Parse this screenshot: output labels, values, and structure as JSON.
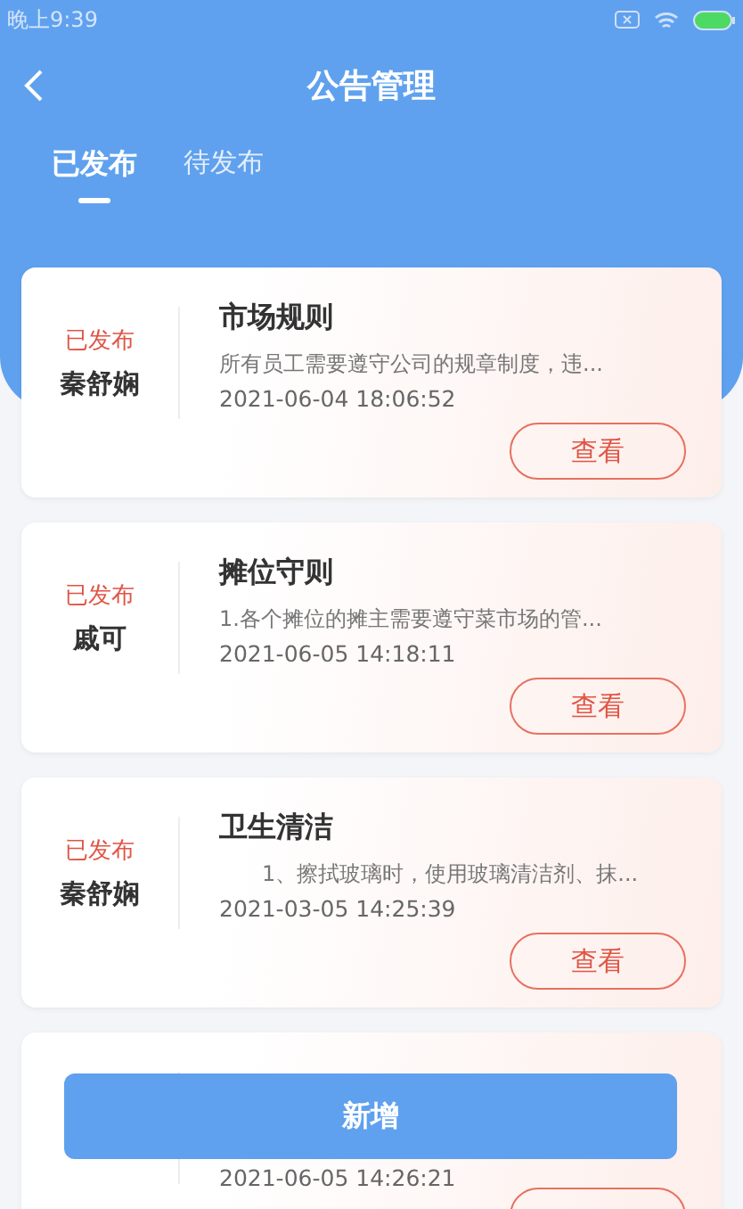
{
  "status_bar": {
    "time": "晚上9:39"
  },
  "header": {
    "title": "公告管理"
  },
  "tabs": [
    {
      "label": "已发布",
      "selected": true
    },
    {
      "label": "待发布",
      "selected": false
    }
  ],
  "notices": [
    {
      "status": "已发布",
      "author": "秦舒娴",
      "title": "市场规则",
      "summary": "所有员工需要遵守公司的规章制度，违...",
      "date": "2021-06-04 18:06:52",
      "button": "查看"
    },
    {
      "status": "已发布",
      "author": "戚可",
      "title": "摊位守则",
      "summary": "1.各个摊位的摊主需要遵守菜市场的管...",
      "date": "2021-06-05 14:18:11",
      "button": "查看"
    },
    {
      "status": "已发布",
      "author": "秦舒娴",
      "title": "卫生清洁",
      "summary": "　　1、擦拭玻璃时，使用玻璃清洁剂、抹...",
      "date": "2021-03-05 14:25:39",
      "button": "查看"
    },
    {
      "date": "2021-06-05 14:26:21"
    }
  ],
  "add_button": {
    "label": "新增"
  }
}
